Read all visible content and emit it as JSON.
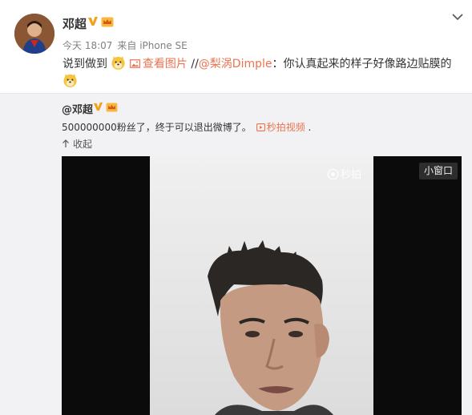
{
  "post": {
    "author": "邓超",
    "timestamp": "今天 18:07",
    "source": "来自 iPhone SE",
    "text_prefix": "说到做到",
    "pic_link_label": "查看图片",
    "repost_separator": " //",
    "mention": "@梨涡Dimple",
    "mention_text": "：你认真起来的样子好像路边贴膜的",
    "icons": [
      "chevron-down-icon",
      "verified-v-icon",
      "vip-crown-icon",
      "doge-emoji-icon",
      "image-link-icon"
    ]
  },
  "repost": {
    "author": "@邓超",
    "text": "500000000粉丝了，终于可以退出微博了。",
    "video_link_label": "秒拍视频",
    "video_link_suffix": " .",
    "collapse_label": "收起",
    "video": {
      "watermark": "秒拍",
      "mini_window_label": "小窗口"
    }
  },
  "colors": {
    "link": "#eb7350",
    "verified": "#f2a21b",
    "repost_bg": "#f2f2f5",
    "meta_text": "#808080"
  }
}
